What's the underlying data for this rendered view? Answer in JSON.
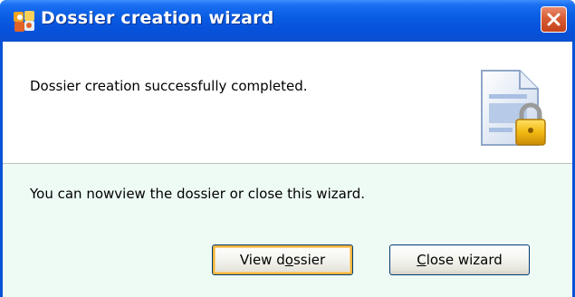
{
  "window": {
    "title": "Dossier creation wizard",
    "close_icon": "close-icon",
    "app_icon": "wizard-app-icon"
  },
  "top_panel": {
    "message": "Dossier creation successfully completed.",
    "icon": "document-lock-icon"
  },
  "bottom_panel": {
    "info": "You can nowview the dossier or close this wizard."
  },
  "buttons": {
    "view": {
      "before": "View d",
      "mnemonic": "o",
      "after": "ssier"
    },
    "close": {
      "before": "",
      "mnemonic": "C",
      "after": "lose wizard"
    }
  },
  "colors": {
    "titlebar": "#0a53d6",
    "close_button": "#d85c33",
    "panel_background": "#eefbf5",
    "default_button_focus": "#f8b33b"
  }
}
